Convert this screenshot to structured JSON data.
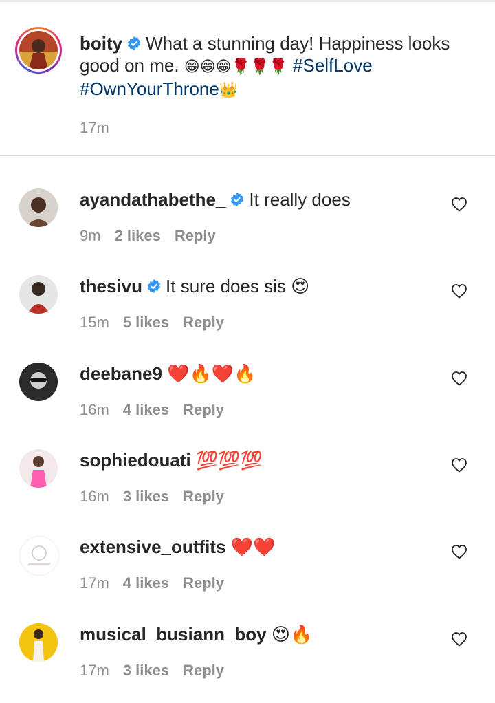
{
  "post": {
    "username": "boity",
    "text": "What a stunning day! Happiness looks good on me.",
    "emojis": "😁😁😁🌹🌹🌹",
    "hashtag1": "#SelfLove",
    "hashtag2": "#OwnYourThrone",
    "crown": "👑",
    "time": "17m"
  },
  "comments": [
    {
      "username": "ayandathabethe_",
      "verified": true,
      "text": "It really does",
      "time": "9m",
      "likes": "2 likes",
      "reply": "Reply"
    },
    {
      "username": "thesivu",
      "verified": true,
      "text": "It sure does sis 😍",
      "time": "15m",
      "likes": "5 likes",
      "reply": "Reply"
    },
    {
      "username": "deebane9",
      "verified": false,
      "text": "❤️🔥❤️🔥",
      "time": "16m",
      "likes": "4 likes",
      "reply": "Reply"
    },
    {
      "username": "sophiedouati",
      "verified": false,
      "text": "💯💯💯",
      "time": "16m",
      "likes": "3 likes",
      "reply": "Reply"
    },
    {
      "username": "extensive_outfits",
      "verified": false,
      "text": "❤️❤️",
      "time": "17m",
      "likes": "4 likes",
      "reply": "Reply"
    },
    {
      "username": "musical_busiann_boy",
      "verified": false,
      "text": "😍🔥",
      "time": "17m",
      "likes": "3 likes",
      "reply": "Reply"
    }
  ]
}
